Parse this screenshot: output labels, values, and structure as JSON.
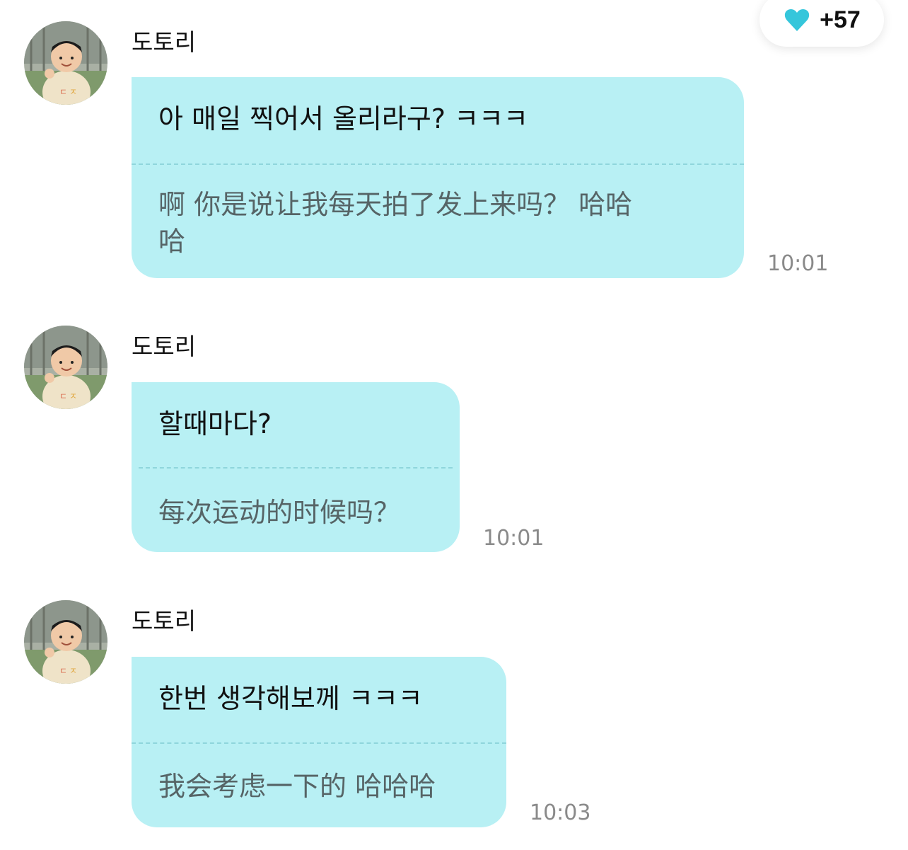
{
  "likes": {
    "icon": "heart-icon",
    "icon_color": "#35c6db",
    "count": "+57"
  },
  "colors": {
    "bubble": "#b8f0f4",
    "divider": "#8fd6dc",
    "translation_text": "#566466",
    "time_text": "#8a8a8a"
  },
  "messages": [
    {
      "sender": "도토리",
      "original": "아 매일 찍어서 올리라구? ㅋㅋㅋ",
      "translation_line1": "啊 你是说让我每天拍了发上来吗？ 哈哈",
      "translation_line2": "哈",
      "time": "10:01"
    },
    {
      "sender": "도토리",
      "original": "할때마다?",
      "translation_line1": "每次运动的时候吗？",
      "time": "10:01"
    },
    {
      "sender": "도토리",
      "original": "한번 생각해보께 ㅋㅋㅋ",
      "translation_line1": "我会考虑一下的 哈哈哈",
      "time": "10:03"
    }
  ]
}
